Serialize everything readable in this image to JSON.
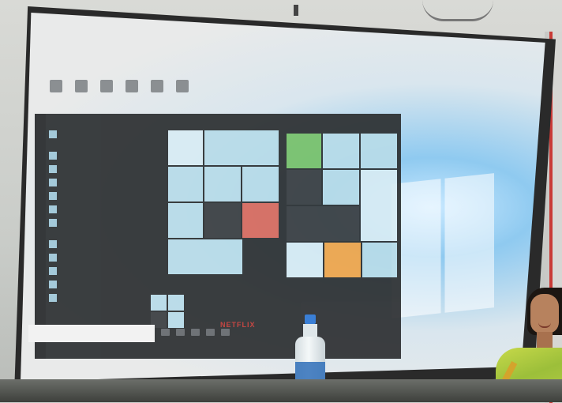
{
  "scene": {
    "screen": {
      "start_menu": {
        "app_list": [
          {
            "label": ""
          },
          {
            "label": ""
          },
          {
            "label": ""
          },
          {
            "label": ""
          },
          {
            "label": ""
          },
          {
            "label": ""
          },
          {
            "label": ""
          },
          {
            "label": ""
          },
          {
            "label": ""
          },
          {
            "label": ""
          },
          {
            "label": ""
          },
          {
            "label": ""
          }
        ],
        "tile_group_1_title": "",
        "tile_group_2_title": "",
        "netflix_tile_text": "NETFLIX"
      }
    },
    "colors": {
      "screen_glow": "#8fcaf0",
      "start_menu_bg": "#2c2f31",
      "tile_blue": "#b8dce9",
      "tile_green": "#78c26a",
      "tile_orange": "#f2a64a",
      "netflix_red": "#c53a35",
      "bottle_cap": "#3a7fd6",
      "sari_green": "#9cbf3a"
    }
  }
}
